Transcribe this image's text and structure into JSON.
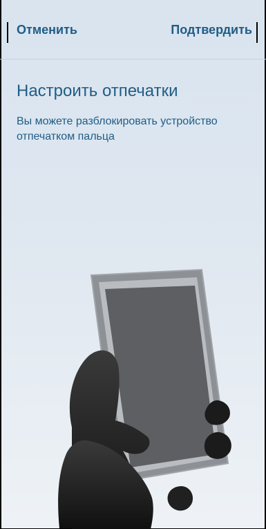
{
  "toolbar": {
    "cancel_label": "Отменить",
    "confirm_label": "Подтвердить"
  },
  "content": {
    "title": "Настроить отпечатки",
    "description": "Вы можете разблокировать устройство отпечатком пальца"
  },
  "illustration": {
    "icon": "hand-holding-phone-illustration"
  },
  "colors": {
    "accent": "#1f5d86",
    "background_top": "#d9e4ef",
    "background_bottom": "#eef2f6"
  }
}
